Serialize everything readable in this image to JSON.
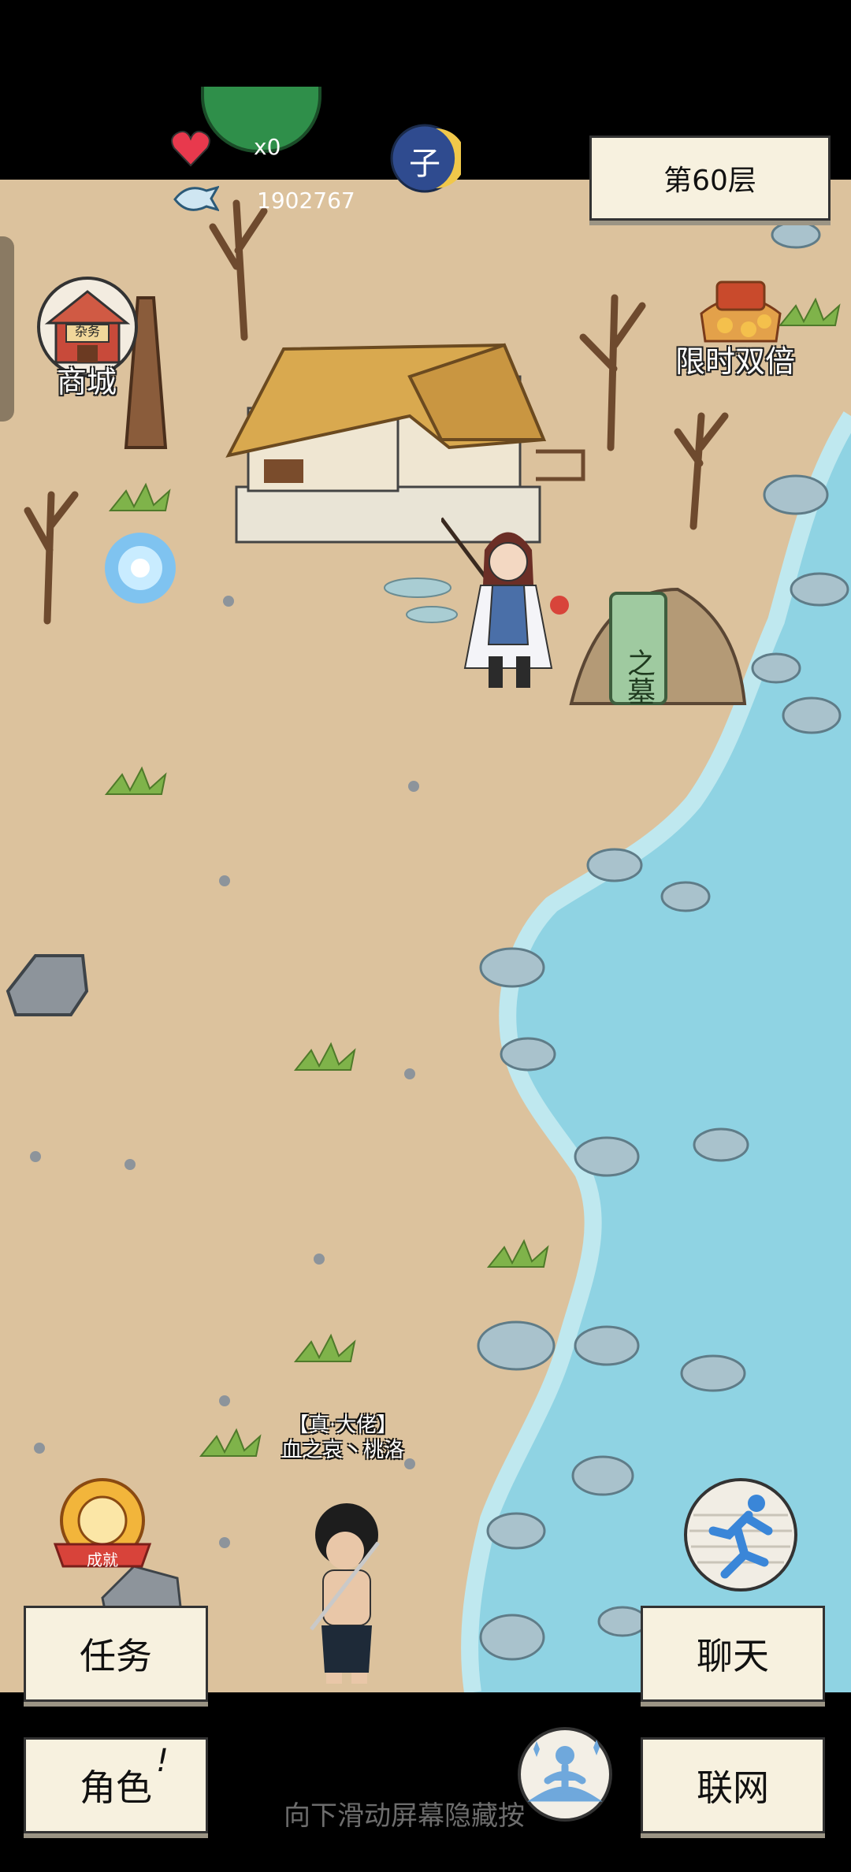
{
  "hud": {
    "hearts_count": "x0",
    "currency_amount": "1902767",
    "clock_char": "子",
    "floor_label": "第60层"
  },
  "map": {
    "shop_label": "商城",
    "shop_sign": "杂务",
    "double_label": "限时双倍",
    "tomb_text": "之墓",
    "player_title": "【真·大佬】",
    "player_name": "血之哀丶桃洛",
    "achievement_badge": "成就"
  },
  "buttons": {
    "tasks": "任务",
    "chat": "聊天",
    "character": "角色",
    "character_mark": "!",
    "network": "联网"
  },
  "footer": {
    "hint": "向下滑动屏幕隐藏按"
  },
  "colors": {
    "sand": "#dcc29d",
    "water": "#8fd3e3",
    "panel": "#f7f1df"
  }
}
